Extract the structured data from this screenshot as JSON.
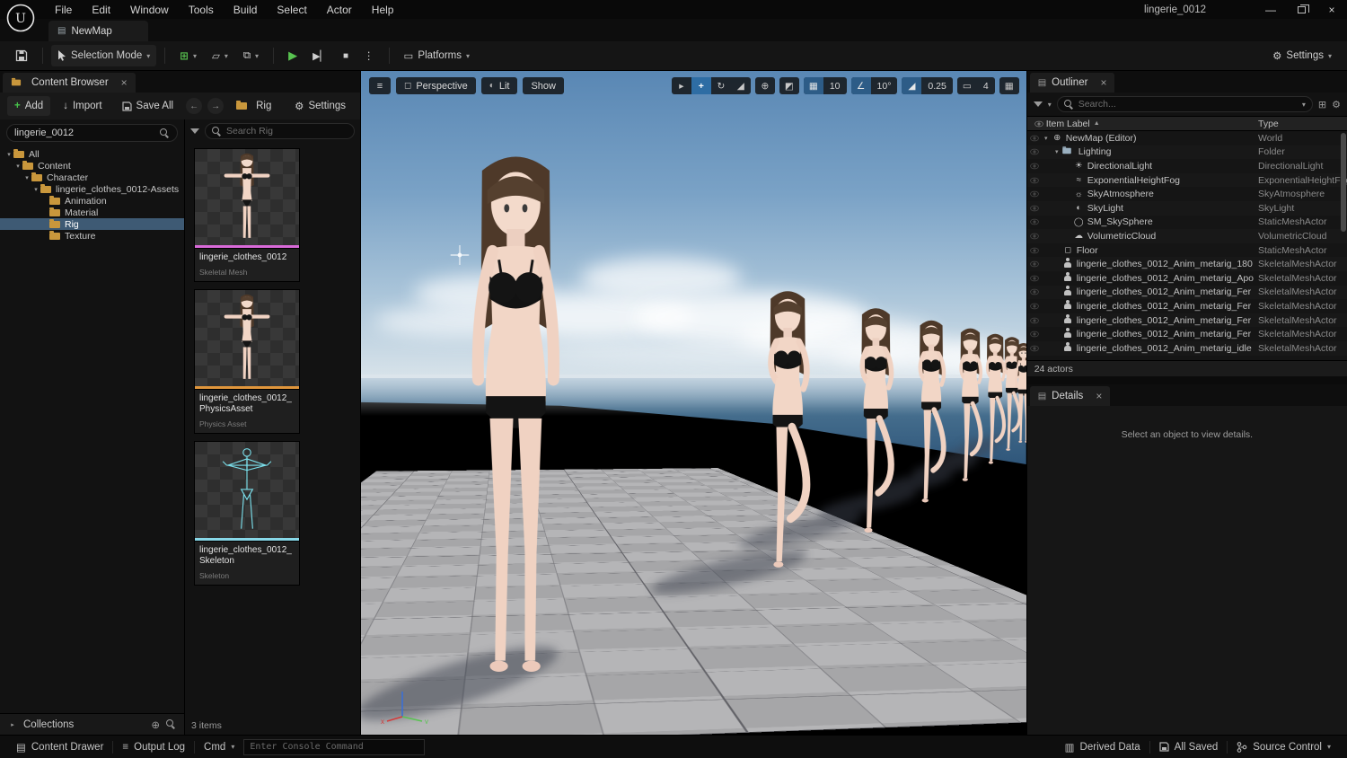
{
  "colors": {
    "selection_blue": "#3e5a74",
    "accent_blue": "#2e6da4",
    "play_green": "#58c350",
    "add_green": "#46c24a",
    "skeletal_mesh_accent": "#d96ad9",
    "physics_asset_accent": "#e0963c",
    "skeleton_accent": "#88d8e8",
    "folder_yellow": "#c9973c"
  },
  "menubar": {
    "items": [
      "File",
      "Edit",
      "Window",
      "Tools",
      "Build",
      "Select",
      "Actor",
      "Help"
    ],
    "window_title": "lingerie_0012"
  },
  "tabbar": {
    "active_tab": "NewMap"
  },
  "toolbar": {
    "selection_mode_label": "Selection Mode",
    "platforms_label": "Platforms",
    "settings_label": "Settings"
  },
  "content_browser": {
    "title": "Content Browser",
    "add_label": "Add",
    "import_label": "Import",
    "save_all_label": "Save All",
    "breadcrumb_folder": "Rig",
    "settings_label": "Settings",
    "search_value": "lingerie_0012",
    "tree": [
      {
        "label": "All",
        "level": 0,
        "expanded": true
      },
      {
        "label": "Content",
        "level": 1,
        "expanded": true
      },
      {
        "label": "Character",
        "level": 2,
        "expanded": true
      },
      {
        "label": "lingerie_clothes_0012-Assets",
        "level": 3,
        "expanded": true
      },
      {
        "label": "Animation",
        "level": 4
      },
      {
        "label": "Material",
        "level": 4
      },
      {
        "label": "Rig",
        "level": 4,
        "selected": true
      },
      {
        "label": "Texture",
        "level": 4
      }
    ],
    "asset_search_placeholder": "Search Rig",
    "assets": [
      {
        "name": "lingerie_clothes_0012",
        "type": "Skeletal Mesh"
      },
      {
        "name": "lingerie_clothes_0012_PhysicsAsset",
        "type": "Physics Asset"
      },
      {
        "name": "lingerie_clothes_0012_Skeleton",
        "type": "Skeleton"
      }
    ],
    "items_count": "3 items",
    "collections_label": "Collections"
  },
  "viewport": {
    "perspective_label": "Perspective",
    "lit_label": "Lit",
    "show_label": "Show",
    "grid_snap_value": "10",
    "rotation_snap_value": "10°",
    "scale_snap_value": "0.25",
    "camera_speed_value": "4",
    "gizmo": {
      "x_label": "x",
      "y_label": "y"
    }
  },
  "outliner": {
    "title": "Outliner",
    "search_placeholder": "Search...",
    "column_label": "Item Label",
    "column_type": "Type",
    "rows": [
      {
        "label": "NewMap (Editor)",
        "type": "World"
      },
      {
        "label": "Lighting",
        "type": "Folder"
      },
      {
        "label": "DirectionalLight",
        "type": "DirectionalLight"
      },
      {
        "label": "ExponentialHeightFog",
        "type": "ExponentialHeightFog"
      },
      {
        "label": "SkyAtmosphere",
        "type": "SkyAtmosphere"
      },
      {
        "label": "SkyLight",
        "type": "SkyLight"
      },
      {
        "label": "SM_SkySphere",
        "type": "StaticMeshActor"
      },
      {
        "label": "VolumetricCloud",
        "type": "VolumetricCloud"
      },
      {
        "label": "Floor",
        "type": "StaticMeshActor"
      },
      {
        "label": "lingerie_clothes_0012_Anim_metarig_180",
        "type": "SkeletalMeshActor"
      },
      {
        "label": "lingerie_clothes_0012_Anim_metarig_Apo",
        "type": "SkeletalMeshActor"
      },
      {
        "label": "lingerie_clothes_0012_Anim_metarig_Fer",
        "type": "SkeletalMeshActor"
      },
      {
        "label": "lingerie_clothes_0012_Anim_metarig_Fer",
        "type": "SkeletalMeshActor"
      },
      {
        "label": "lingerie_clothes_0012_Anim_metarig_Fer",
        "type": "SkeletalMeshActor"
      },
      {
        "label": "lingerie_clothes_0012_Anim_metarig_Fer",
        "type": "SkeletalMeshActor"
      },
      {
        "label": "lingerie_clothes_0012_Anim_metarig_idle",
        "type": "SkeletalMeshActor"
      }
    ],
    "status": "24 actors"
  },
  "details": {
    "title": "Details",
    "empty_message": "Select an object to view details."
  },
  "statusbar": {
    "content_drawer_label": "Content Drawer",
    "output_log_label": "Output Log",
    "cmd_label": "Cmd",
    "console_placeholder": "Enter Console Command",
    "derived_data_label": "Derived Data",
    "all_saved_label": "All Saved",
    "source_control_label": "Source Control"
  }
}
